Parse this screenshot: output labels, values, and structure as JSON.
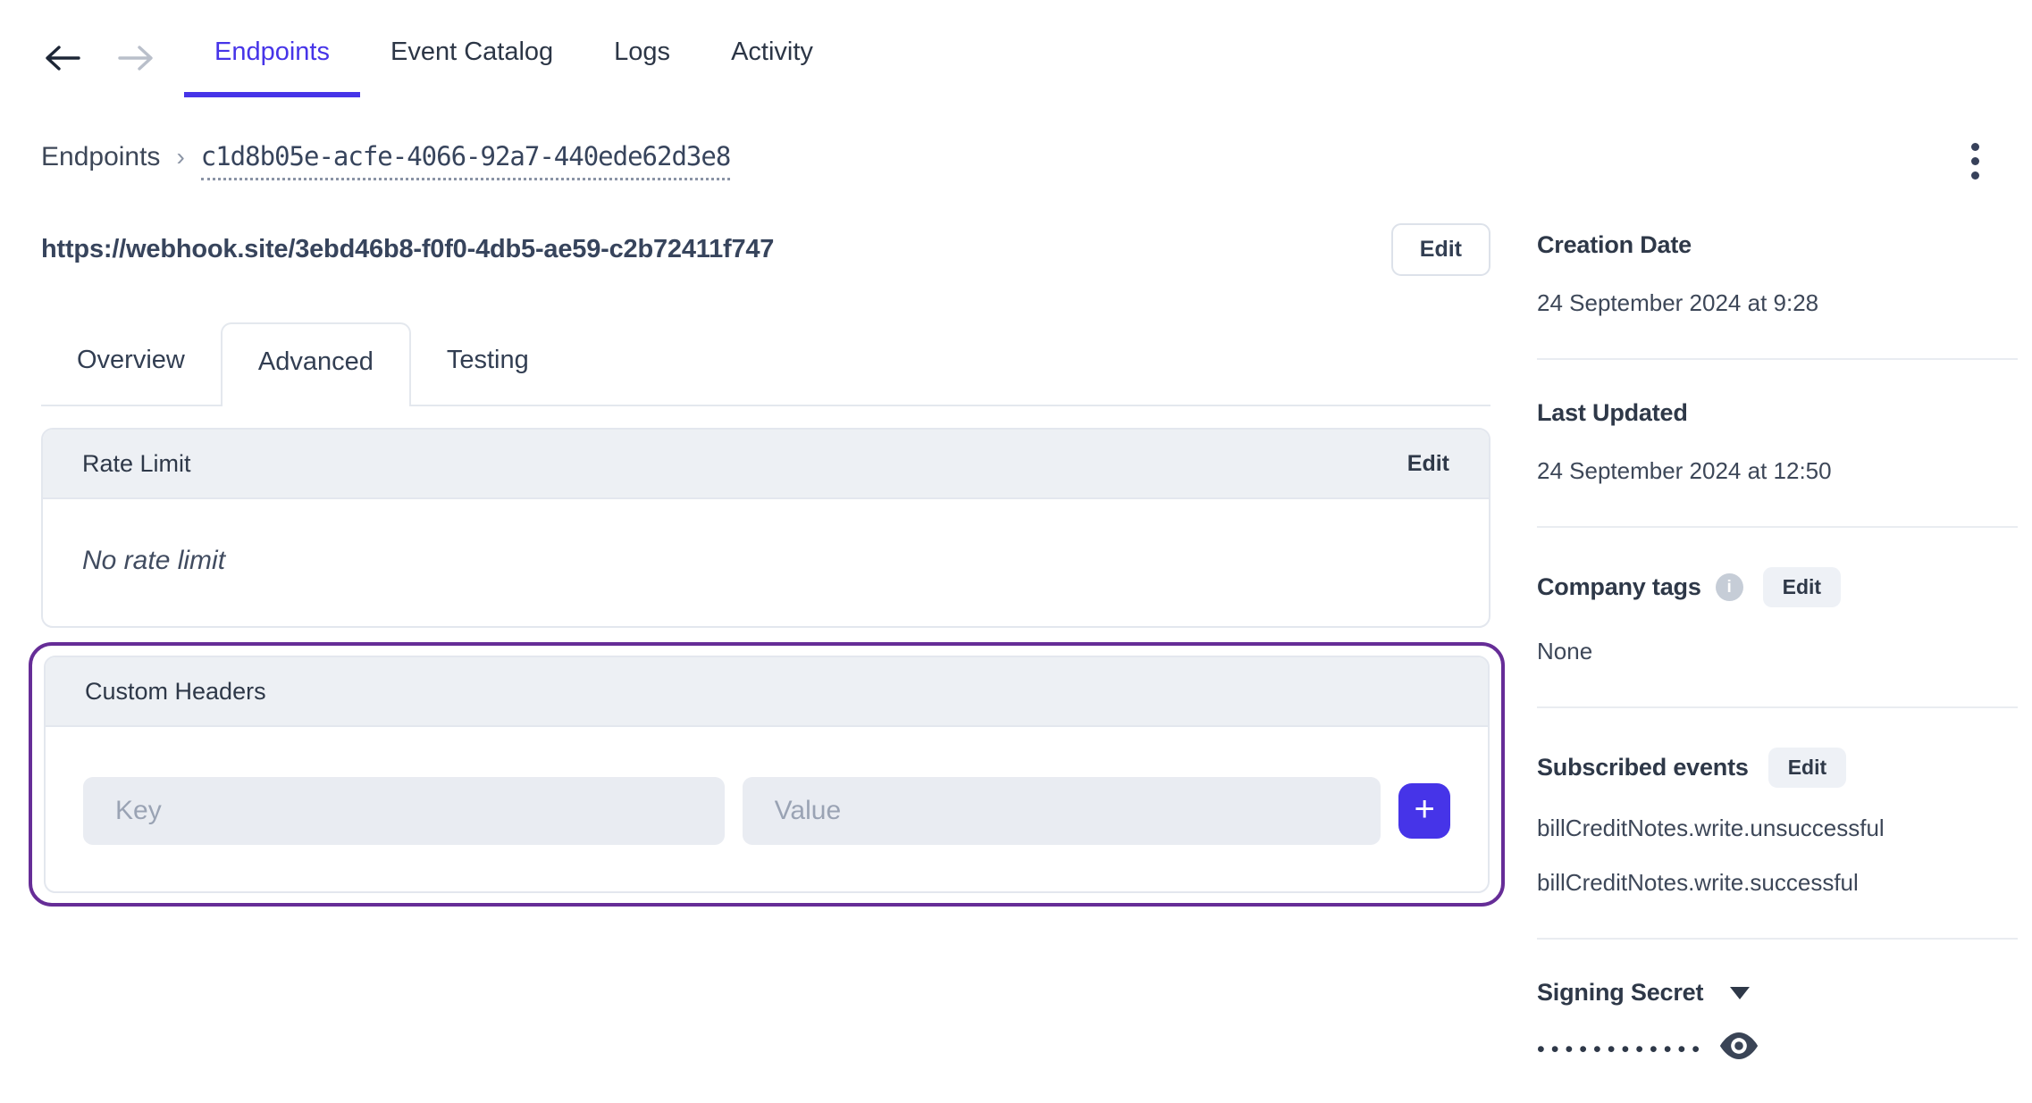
{
  "nav": {
    "tabs": [
      {
        "label": "Endpoints",
        "active": true
      },
      {
        "label": "Event Catalog",
        "active": false
      },
      {
        "label": "Logs",
        "active": false
      },
      {
        "label": "Activity",
        "active": false
      }
    ]
  },
  "breadcrumb": {
    "root": "Endpoints",
    "separator": "›",
    "endpoint_id": "c1d8b05e-acfe-4066-92a7-440ede62d3e8"
  },
  "endpoint": {
    "url": "https://webhook.site/3ebd46b8-f0f0-4db5-ae59-c2b72411f747",
    "edit_label": "Edit"
  },
  "detail_tabs": {
    "overview": "Overview",
    "advanced": "Advanced",
    "testing": "Testing",
    "active": "Advanced"
  },
  "rate_limit": {
    "title": "Rate Limit",
    "edit_label": "Edit",
    "empty_text": "No rate limit"
  },
  "custom_headers": {
    "title": "Custom Headers",
    "key_placeholder": "Key",
    "key_value": "",
    "value_placeholder": "Value",
    "value_value": "",
    "add_label": "+"
  },
  "sidebar": {
    "creation_date": {
      "label": "Creation Date",
      "value": "24 September 2024 at 9:28"
    },
    "last_updated": {
      "label": "Last Updated",
      "value": "24 September 2024 at 12:50"
    },
    "company_tags": {
      "label": "Company tags",
      "info_icon": "i",
      "edit_label": "Edit",
      "value": "None"
    },
    "subscribed_events": {
      "label": "Subscribed events",
      "edit_label": "Edit",
      "events": [
        "billCreditNotes.write.unsuccessful",
        "billCreditNotes.write.successful"
      ]
    },
    "signing_secret": {
      "label": "Signing Secret",
      "masked_value": "••••••••••••"
    }
  },
  "colors": {
    "accent_indigo": "#4634e8",
    "highlight_outline_purple": "#662d97",
    "card_header_bg": "#edf0f4",
    "input_bg": "#e9ecf2",
    "text_strong": "#2e3848",
    "text_regular": "#3d4758",
    "disabled_arrow": "#b9bfca"
  }
}
